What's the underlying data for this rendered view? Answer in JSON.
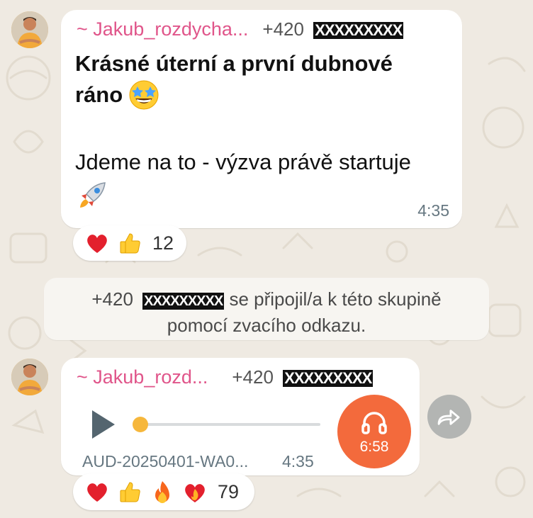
{
  "messages": [
    {
      "sender_name": "~ Jakub_rozdycha...",
      "sender_phone": "+420",
      "sender_phone_redacted": "XXXXXXXXX",
      "text_line1": "Krásné úterní a první dubnové",
      "text_line2": "ráno",
      "text_line3": "Jdeme na to - výzva právě startuje",
      "time": "4:35",
      "reactions": {
        "icons": [
          "heart-icon",
          "thumbs-up-icon"
        ],
        "count": "12"
      }
    },
    {
      "sender_name": "~ Jakub_rozd...",
      "sender_phone": "+420",
      "sender_phone_redacted": "XXXXXXXXX",
      "audio": {
        "file_name": "AUD-20250401-WA0...",
        "time": "4:35",
        "duration": "6:58",
        "progress": 0.0
      },
      "reactions": {
        "icons": [
          "heart-icon",
          "thumbs-up-icon",
          "fire-icon",
          "heart-on-fire-icon"
        ],
        "count": "79"
      }
    }
  ],
  "system": {
    "phone": "+420",
    "phone_redacted": "XXXXXXXXX",
    "line1_suffix": "se připojil/a k této skupině",
    "line2": "pomocí zvacího odkazu."
  },
  "colors": {
    "sender_name": "#e0558a",
    "audio_button": "#f36a3c",
    "audio_knob": "#f6b73c",
    "background": "#efeae2"
  }
}
